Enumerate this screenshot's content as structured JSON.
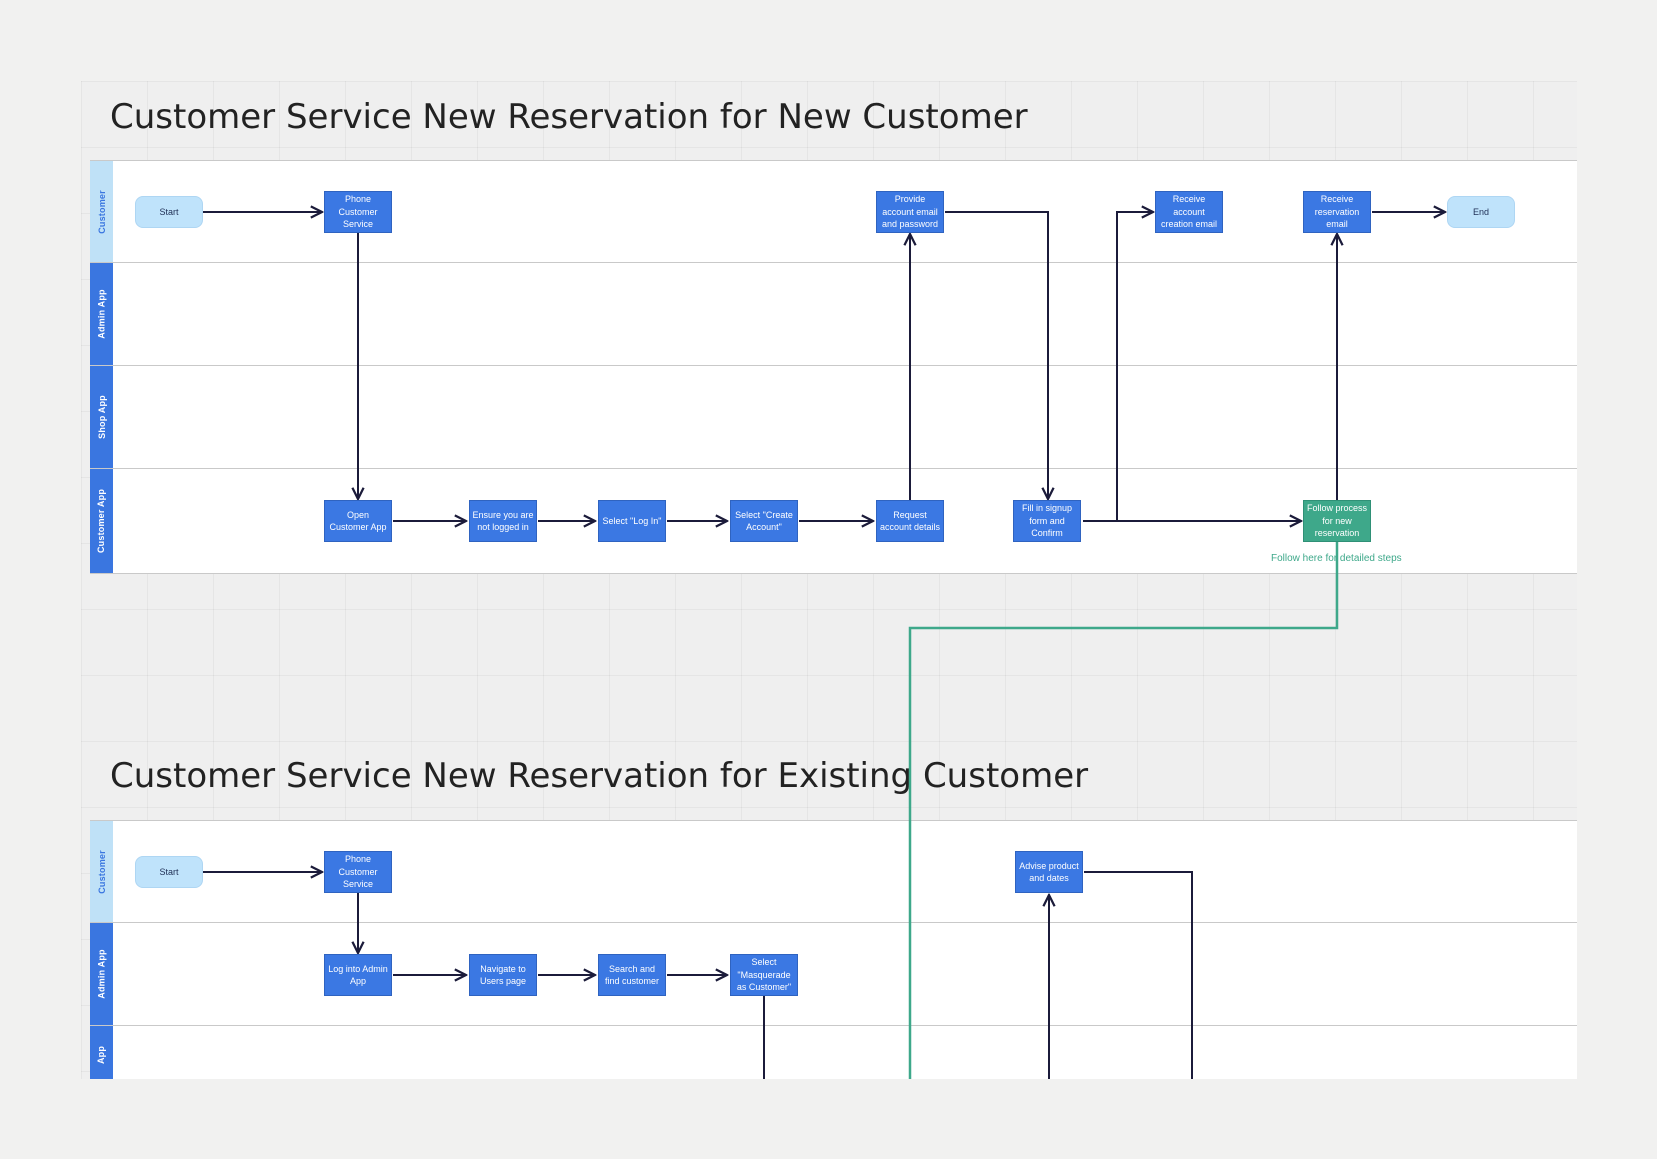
{
  "diagram1": {
    "title": "Customer Service New Reservation for New Customer",
    "lanes": [
      "Customer",
      "Admin App",
      "Shop App",
      "Customer App"
    ],
    "nodes": {
      "start": "Start",
      "phone": "Phone Customer Service",
      "provide": "Provide account email and password",
      "receive_account": "Receive account creation email",
      "receive_reservation": "Receive reservation email",
      "end": "End",
      "open_app": "Open Customer App",
      "ensure": "Ensure you are not logged in",
      "select_login": "Select \"Log In\"",
      "select_create": "Select \"Create Account\"",
      "request": "Request account details",
      "fill": "Fill in signup form and Confirm",
      "follow": "Follow process for new reservation"
    },
    "annotation": "Follow here for detailed steps"
  },
  "diagram2": {
    "title": "Customer Service New Reservation for Existing Customer",
    "lanes": [
      "Customer",
      "Admin App",
      "App"
    ],
    "nodes": {
      "start": "Start",
      "phone": "Phone Customer Service",
      "advise": "Advise product and dates",
      "login_admin": "Log into Admin App",
      "navigate": "Navigate to Users page",
      "search": "Search and find customer",
      "masquerade": "Select \"Masquerade as Customer\""
    }
  },
  "colors": {
    "process": "#3b78e3",
    "terminal": "#bfe3fb",
    "highlight": "#3ea88a",
    "connector": "#1b1b3a"
  }
}
